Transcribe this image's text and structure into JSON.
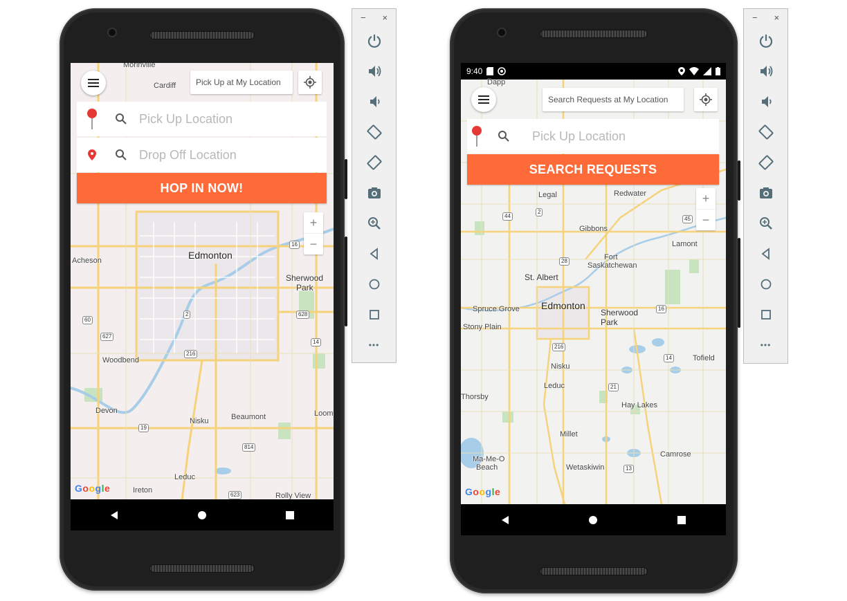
{
  "colors": {
    "accent": "#ff6a39",
    "pin_red": "#e53935",
    "map_bg": "#f3efe6",
    "road": "#f6d27a",
    "water": "#a8cde8",
    "park": "#bfe0b4"
  },
  "phone1": {
    "map": {
      "labels": [
        "Morinville",
        "Cardiff",
        "Acheson",
        "Edmonton",
        "Sherwood",
        "Park",
        "Woodbend",
        "Devon",
        "Nisku",
        "Beaumont",
        "Leduc",
        "Ireton",
        "Rolly View",
        "Loom"
      ],
      "highways": [
        "16",
        "2",
        "628",
        "60",
        "627",
        "216",
        "14",
        "19",
        "814",
        "623"
      ]
    },
    "location_chip": "Pick Up at My Location",
    "pickup_placeholder": "Pick Up Location",
    "dropoff_placeholder": "Drop Off Location",
    "cta": "HOP IN NOW!",
    "zoom_in": "+",
    "zoom_out": "−",
    "google": [
      "G",
      "o",
      "o",
      "g",
      "l",
      "e"
    ]
  },
  "phone2": {
    "status": {
      "time": "9:40"
    },
    "map": {
      "labels": [
        "Dapp",
        "Legal",
        "Redwater",
        "Gibbons",
        "Lamont",
        "Fort",
        "Saskatchewan",
        "St. Albert",
        "Edmonton",
        "Spruce Grove",
        "Stony Plain",
        "Sherwood",
        "Park",
        "Nisku",
        "Leduc",
        "Tofield",
        "Hay Lakes",
        "Thorsby",
        "Millet",
        "Camrose",
        "Ma-Me-O",
        "Beach",
        "Wetaskiwin"
      ],
      "highways": [
        "2",
        "44",
        "45",
        "28",
        "16",
        "216",
        "21",
        "14",
        "13"
      ]
    },
    "location_chip": "Search Requests at My Location",
    "pickup_placeholder": "Pick Up Location",
    "cta": "SEARCH REQUESTS",
    "zoom_in": "+",
    "zoom_out": "−",
    "google": [
      "G",
      "o",
      "o",
      "g",
      "l",
      "e"
    ]
  },
  "emulator": {
    "minimize": "−",
    "close": "×",
    "buttons": [
      "power-icon",
      "volume-up-icon",
      "volume-down-icon",
      "rotate-left-icon",
      "rotate-right-icon",
      "camera-icon",
      "zoom-icon",
      "back-icon",
      "home-icon",
      "overview-icon",
      "more-icon"
    ],
    "more": "•••"
  }
}
